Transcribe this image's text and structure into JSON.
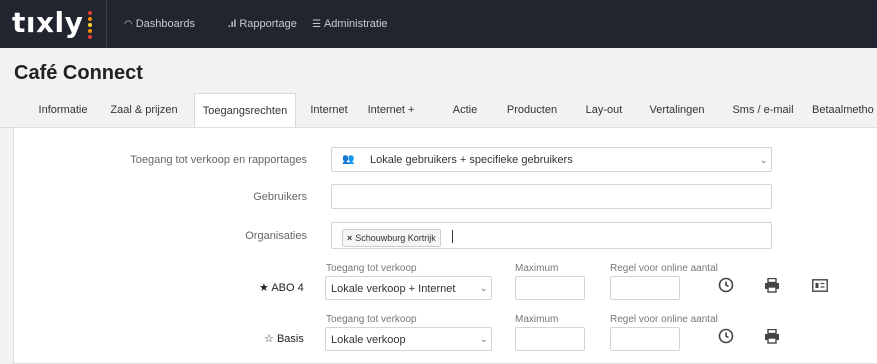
{
  "app": {
    "logo": "tıxly"
  },
  "nav": [
    {
      "label": "Dashboards",
      "icon": "gauge-icon"
    },
    {
      "label": "Rapportage",
      "icon": "bar-chart-icon"
    },
    {
      "label": "Administratie",
      "icon": "database-icon"
    }
  ],
  "page": {
    "title": "Café Connect"
  },
  "tabs": [
    {
      "label": "Informatie"
    },
    {
      "label": "Zaal & prijzen"
    },
    {
      "label": "Toegangsrechten",
      "active": true
    },
    {
      "label": "Internet"
    },
    {
      "label": "Internet +"
    },
    {
      "label": "Actie"
    },
    {
      "label": "Producten"
    },
    {
      "label": "Lay-out"
    },
    {
      "label": "Vertalingen"
    },
    {
      "label": "Sms / e-mail"
    },
    {
      "label": "Betaalmetho"
    }
  ],
  "form": {
    "access_label": "Toegang tot verkoop en rapportages",
    "access_value": "Lokale gebruikers + specifieke gebruikers",
    "users_label": "Gebruikers",
    "users_value": "",
    "orgs_label": "Organisaties",
    "orgs_tag": "Schouwburg Kortrijk"
  },
  "rows": [
    {
      "name": "ABO 4",
      "star": "★",
      "access_label": "Toegang tot verkoop",
      "access_value": "Lokale verkoop + Internet",
      "max_label": "Maximum",
      "max_value": "",
      "rule_label": "Regel voor online aantal",
      "rule_value": ""
    },
    {
      "name": "Basis",
      "star": "☆",
      "access_label": "Toegang tot verkoop",
      "access_value": "Lokale verkoop",
      "max_label": "Maximum",
      "max_value": "",
      "rule_label": "Regel voor online aantal",
      "rule_value": ""
    }
  ],
  "colors": {
    "topbar": "#202530",
    "logo_dots": [
      "#e53935",
      "#fb8c00",
      "#fdd835",
      "#43a047"
    ]
  }
}
